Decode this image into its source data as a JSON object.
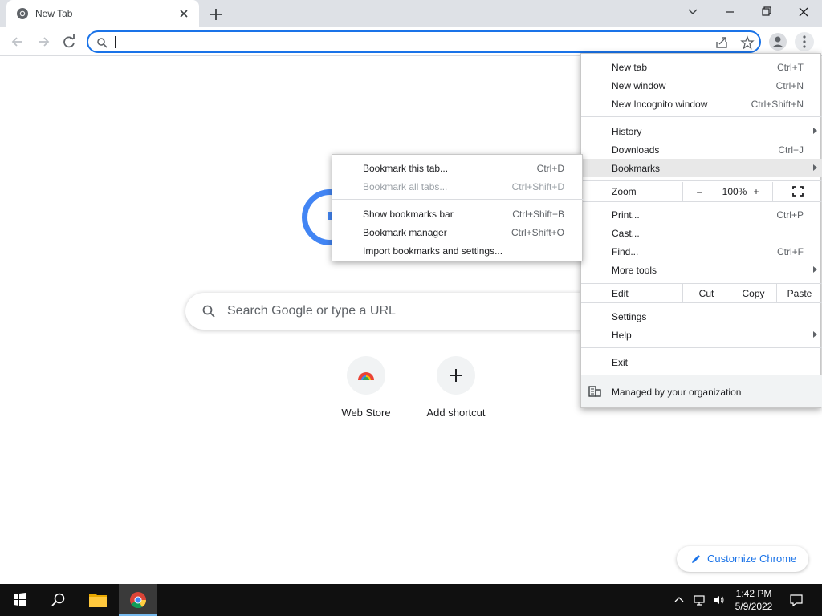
{
  "tab": {
    "title": "New Tab"
  },
  "omnibox": {
    "value": ""
  },
  "search": {
    "placeholder": "Search Google or type a URL"
  },
  "shortcuts": [
    {
      "label": "Web Store"
    },
    {
      "label": "Add shortcut"
    }
  ],
  "customize": {
    "label": "Customize Chrome"
  },
  "chrome_menu": {
    "new_tab": {
      "label": "New tab",
      "shortcut": "Ctrl+T"
    },
    "new_window": {
      "label": "New window",
      "shortcut": "Ctrl+N"
    },
    "new_incognito": {
      "label": "New Incognito window",
      "shortcut": "Ctrl+Shift+N"
    },
    "history": {
      "label": "History"
    },
    "downloads": {
      "label": "Downloads",
      "shortcut": "Ctrl+J"
    },
    "bookmarks": {
      "label": "Bookmarks"
    },
    "zoom": {
      "label": "Zoom",
      "minus": "–",
      "value": "100%",
      "plus": "+"
    },
    "print": {
      "label": "Print...",
      "shortcut": "Ctrl+P"
    },
    "cast": {
      "label": "Cast..."
    },
    "find": {
      "label": "Find...",
      "shortcut": "Ctrl+F"
    },
    "more_tools": {
      "label": "More tools"
    },
    "edit": {
      "label": "Edit",
      "cut": "Cut",
      "copy": "Copy",
      "paste": "Paste"
    },
    "settings": {
      "label": "Settings"
    },
    "help": {
      "label": "Help"
    },
    "exit": {
      "label": "Exit"
    },
    "managed": {
      "label": "Managed by your organization"
    }
  },
  "bookmarks_menu": {
    "bookmark_tab": {
      "label": "Bookmark this tab...",
      "shortcut": "Ctrl+D"
    },
    "bookmark_all": {
      "label": "Bookmark all tabs...",
      "shortcut": "Ctrl+Shift+D"
    },
    "show_bar": {
      "label": "Show bookmarks bar",
      "shortcut": "Ctrl+Shift+B"
    },
    "manager": {
      "label": "Bookmark manager",
      "shortcut": "Ctrl+Shift+O"
    },
    "import": {
      "label": "Import bookmarks and settings..."
    }
  },
  "taskbar": {
    "time": "1:42 PM",
    "date": "5/9/2022"
  },
  "colors": {
    "accent": "#1a73e8",
    "google_blue": "#4285f4",
    "tab_strip": "#dee1e6",
    "taskbar": "#101010"
  }
}
